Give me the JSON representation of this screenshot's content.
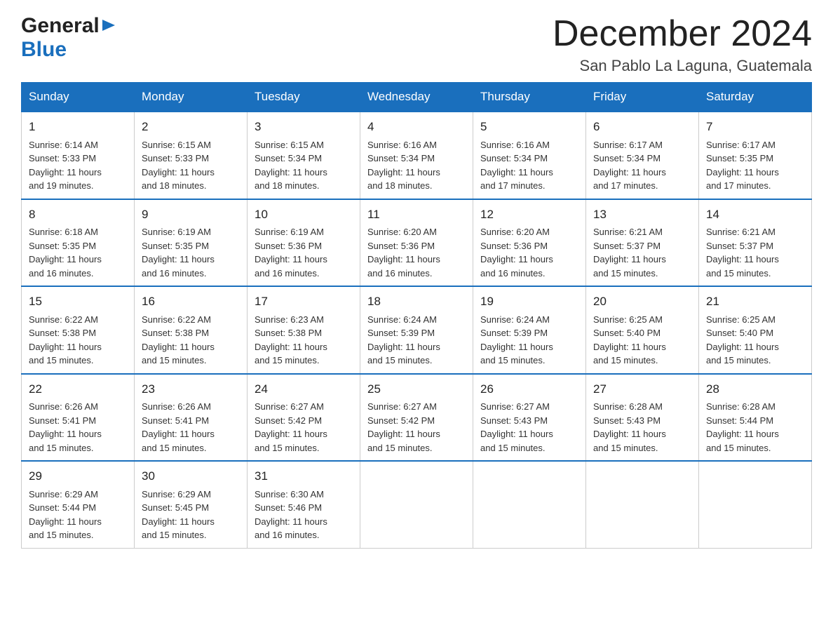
{
  "logo": {
    "general": "General",
    "blue": "Blue"
  },
  "header": {
    "month_year": "December 2024",
    "location": "San Pablo La Laguna, Guatemala"
  },
  "days_of_week": [
    "Sunday",
    "Monday",
    "Tuesday",
    "Wednesday",
    "Thursday",
    "Friday",
    "Saturday"
  ],
  "weeks": [
    [
      {
        "day": "1",
        "sunrise": "6:14 AM",
        "sunset": "5:33 PM",
        "daylight": "11 hours and 19 minutes."
      },
      {
        "day": "2",
        "sunrise": "6:15 AM",
        "sunset": "5:33 PM",
        "daylight": "11 hours and 18 minutes."
      },
      {
        "day": "3",
        "sunrise": "6:15 AM",
        "sunset": "5:34 PM",
        "daylight": "11 hours and 18 minutes."
      },
      {
        "day": "4",
        "sunrise": "6:16 AM",
        "sunset": "5:34 PM",
        "daylight": "11 hours and 18 minutes."
      },
      {
        "day": "5",
        "sunrise": "6:16 AM",
        "sunset": "5:34 PM",
        "daylight": "11 hours and 17 minutes."
      },
      {
        "day": "6",
        "sunrise": "6:17 AM",
        "sunset": "5:34 PM",
        "daylight": "11 hours and 17 minutes."
      },
      {
        "day": "7",
        "sunrise": "6:17 AM",
        "sunset": "5:35 PM",
        "daylight": "11 hours and 17 minutes."
      }
    ],
    [
      {
        "day": "8",
        "sunrise": "6:18 AM",
        "sunset": "5:35 PM",
        "daylight": "11 hours and 16 minutes."
      },
      {
        "day": "9",
        "sunrise": "6:19 AM",
        "sunset": "5:35 PM",
        "daylight": "11 hours and 16 minutes."
      },
      {
        "day": "10",
        "sunrise": "6:19 AM",
        "sunset": "5:36 PM",
        "daylight": "11 hours and 16 minutes."
      },
      {
        "day": "11",
        "sunrise": "6:20 AM",
        "sunset": "5:36 PM",
        "daylight": "11 hours and 16 minutes."
      },
      {
        "day": "12",
        "sunrise": "6:20 AM",
        "sunset": "5:36 PM",
        "daylight": "11 hours and 16 minutes."
      },
      {
        "day": "13",
        "sunrise": "6:21 AM",
        "sunset": "5:37 PM",
        "daylight": "11 hours and 15 minutes."
      },
      {
        "day": "14",
        "sunrise": "6:21 AM",
        "sunset": "5:37 PM",
        "daylight": "11 hours and 15 minutes."
      }
    ],
    [
      {
        "day": "15",
        "sunrise": "6:22 AM",
        "sunset": "5:38 PM",
        "daylight": "11 hours and 15 minutes."
      },
      {
        "day": "16",
        "sunrise": "6:22 AM",
        "sunset": "5:38 PM",
        "daylight": "11 hours and 15 minutes."
      },
      {
        "day": "17",
        "sunrise": "6:23 AM",
        "sunset": "5:38 PM",
        "daylight": "11 hours and 15 minutes."
      },
      {
        "day": "18",
        "sunrise": "6:24 AM",
        "sunset": "5:39 PM",
        "daylight": "11 hours and 15 minutes."
      },
      {
        "day": "19",
        "sunrise": "6:24 AM",
        "sunset": "5:39 PM",
        "daylight": "11 hours and 15 minutes."
      },
      {
        "day": "20",
        "sunrise": "6:25 AM",
        "sunset": "5:40 PM",
        "daylight": "11 hours and 15 minutes."
      },
      {
        "day": "21",
        "sunrise": "6:25 AM",
        "sunset": "5:40 PM",
        "daylight": "11 hours and 15 minutes."
      }
    ],
    [
      {
        "day": "22",
        "sunrise": "6:26 AM",
        "sunset": "5:41 PM",
        "daylight": "11 hours and 15 minutes."
      },
      {
        "day": "23",
        "sunrise": "6:26 AM",
        "sunset": "5:41 PM",
        "daylight": "11 hours and 15 minutes."
      },
      {
        "day": "24",
        "sunrise": "6:27 AM",
        "sunset": "5:42 PM",
        "daylight": "11 hours and 15 minutes."
      },
      {
        "day": "25",
        "sunrise": "6:27 AM",
        "sunset": "5:42 PM",
        "daylight": "11 hours and 15 minutes."
      },
      {
        "day": "26",
        "sunrise": "6:27 AM",
        "sunset": "5:43 PM",
        "daylight": "11 hours and 15 minutes."
      },
      {
        "day": "27",
        "sunrise": "6:28 AM",
        "sunset": "5:43 PM",
        "daylight": "11 hours and 15 minutes."
      },
      {
        "day": "28",
        "sunrise": "6:28 AM",
        "sunset": "5:44 PM",
        "daylight": "11 hours and 15 minutes."
      }
    ],
    [
      {
        "day": "29",
        "sunrise": "6:29 AM",
        "sunset": "5:44 PM",
        "daylight": "11 hours and 15 minutes."
      },
      {
        "day": "30",
        "sunrise": "6:29 AM",
        "sunset": "5:45 PM",
        "daylight": "11 hours and 15 minutes."
      },
      {
        "day": "31",
        "sunrise": "6:30 AM",
        "sunset": "5:46 PM",
        "daylight": "11 hours and 16 minutes."
      },
      null,
      null,
      null,
      null
    ]
  ],
  "cell_labels": {
    "sunrise": "Sunrise: ",
    "sunset": "Sunset: ",
    "daylight": "Daylight: "
  }
}
